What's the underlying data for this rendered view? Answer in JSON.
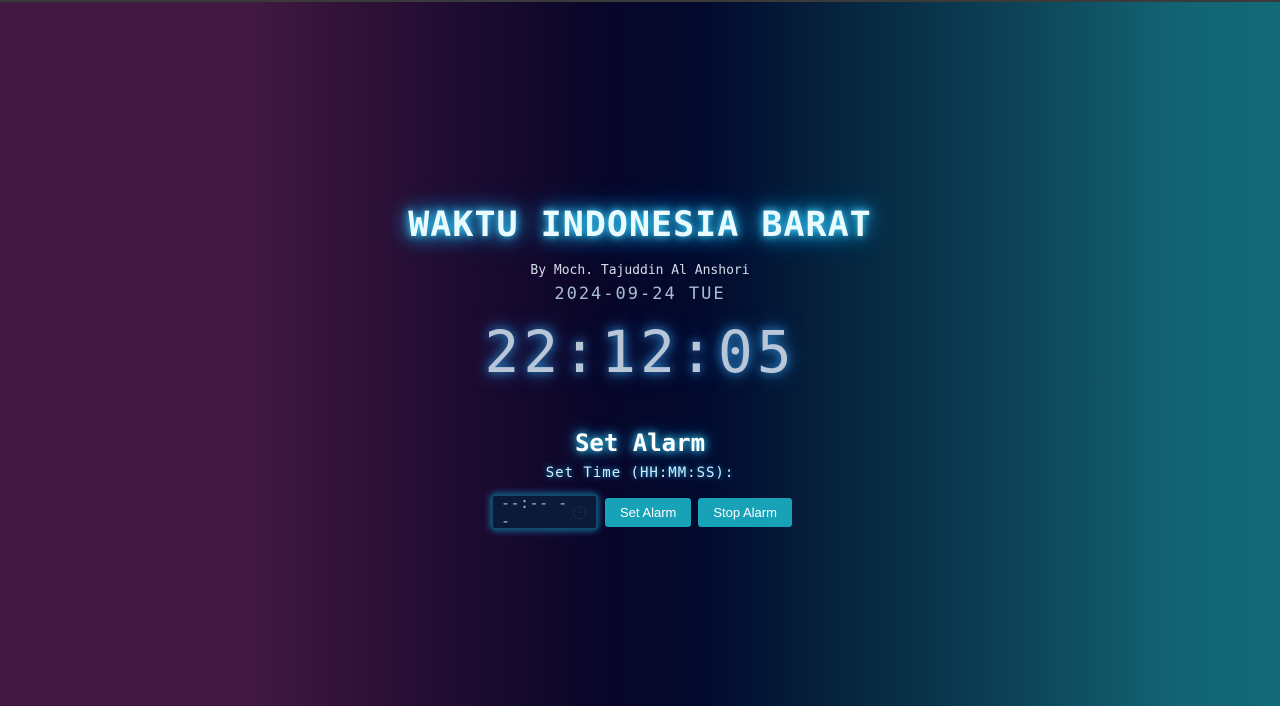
{
  "header": {
    "title": "WAKTU INDONESIA BARAT",
    "author": "By Moch. Tajuddin Al Anshori",
    "date": "2024-09-24 TUE",
    "time": "22:12:05"
  },
  "alarm": {
    "title": "Set Alarm",
    "label": "Set Time (HH:MM:SS):",
    "input_value": "--:-- --",
    "set_button": "Set Alarm",
    "stop_button": "Stop Alarm"
  },
  "colors": {
    "accent": "#17a2b8",
    "glow": "#3fd6ff"
  },
  "icons": {
    "time_picker": "clock-icon"
  }
}
